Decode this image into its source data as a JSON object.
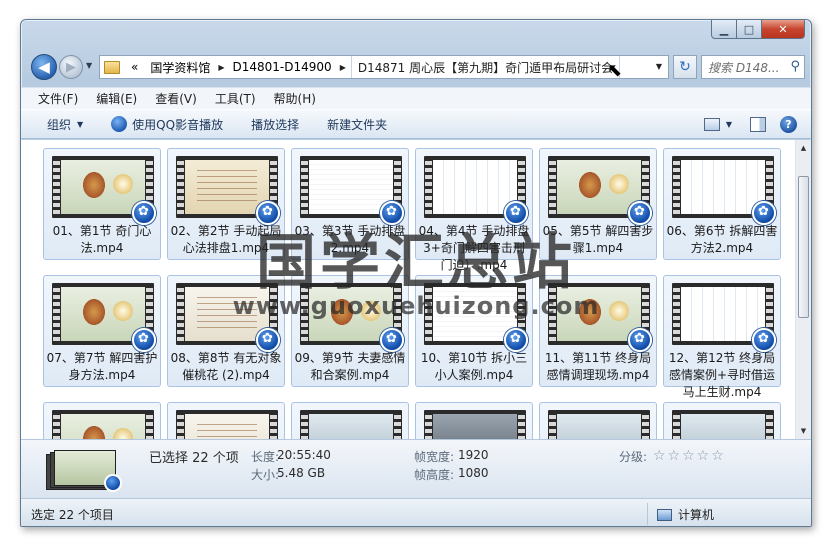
{
  "window": {
    "caption": {
      "minimize": "▁",
      "maximize": "□",
      "close": "✕"
    }
  },
  "nav": {
    "back_icon": "◀",
    "forward_icon": "▶",
    "recent_icon": "▼",
    "breadcrumb_overflow": "«",
    "breadcrumb": [
      "国学资料馆",
      "D14801-D14900"
    ],
    "current_folder": "D14871 周心辰【第九期】奇门遁甲布局研讨会",
    "refresh_icon": "↻",
    "search_placeholder": "搜索 D148...",
    "search_icon": "⚲"
  },
  "menubar": [
    "文件(F)",
    "编辑(E)",
    "查看(V)",
    "工具(T)",
    "帮助(H)"
  ],
  "toolbar": {
    "organize": "组织",
    "play_qq": "使用QQ影音播放",
    "play_selection": "播放选择",
    "new_folder": "新建文件夹",
    "help": "?"
  },
  "files": [
    {
      "name": "01、第1节  奇门心法.mp4",
      "thumb": "t1"
    },
    {
      "name": "02、第2节 手动起局心法排盘1.mp4",
      "thumb": "t2"
    },
    {
      "name": "03、第3节 手动排盘2.mp4",
      "thumb": "t3"
    },
    {
      "name": "04、第4节 手动排盘3+奇门解四害击刑门迫）.mp4",
      "thumb": "t4"
    },
    {
      "name": "05、第5节 解四害步骤1.mp4",
      "thumb": "t1"
    },
    {
      "name": "06、第6节 拆解四害方法2.mp4",
      "thumb": "t4"
    },
    {
      "name": "07、第7节 解四害护身方法.mp4",
      "thumb": "t1"
    },
    {
      "name": "08、第8节 有无对象催桃花 (2).mp4",
      "thumb": "t5"
    },
    {
      "name": "09、第9节 夫妻感情和合案例.mp4",
      "thumb": "t1"
    },
    {
      "name": "10、第10节 拆小三小人案例.mp4",
      "thumb": "t3"
    },
    {
      "name": "11、第11节 终身局感情调理现场.mp4",
      "thumb": "t1"
    },
    {
      "name": "12、第12节 终身局感情案例+寻时借运马上生财.mp4",
      "thumb": "t4"
    },
    {
      "name": "",
      "thumb": "t1"
    },
    {
      "name": "",
      "thumb": "t5"
    },
    {
      "name": "",
      "thumb": "t6"
    },
    {
      "name": "",
      "thumb": "t7"
    },
    {
      "name": "",
      "thumb": "t6"
    },
    {
      "name": "",
      "thumb": "t6"
    }
  ],
  "details": {
    "selected": "已选择 22 个项",
    "length_label": "长度:",
    "length_value": "20:55:40",
    "size_label": "大小:",
    "size_value": "5.48 GB",
    "frame_width_label": "帧宽度:",
    "frame_width_value": "1920",
    "frame_height_label": "帧高度:",
    "frame_height_value": "1080",
    "rating_label": "分级:",
    "rating_stars": "☆☆☆☆☆",
    "rating_value": 0
  },
  "status": {
    "selection": "选定 22 个项目",
    "location": "计算机"
  },
  "watermark": {
    "title": "国学汇总站",
    "url": "www.guoxuehuizong.com"
  }
}
